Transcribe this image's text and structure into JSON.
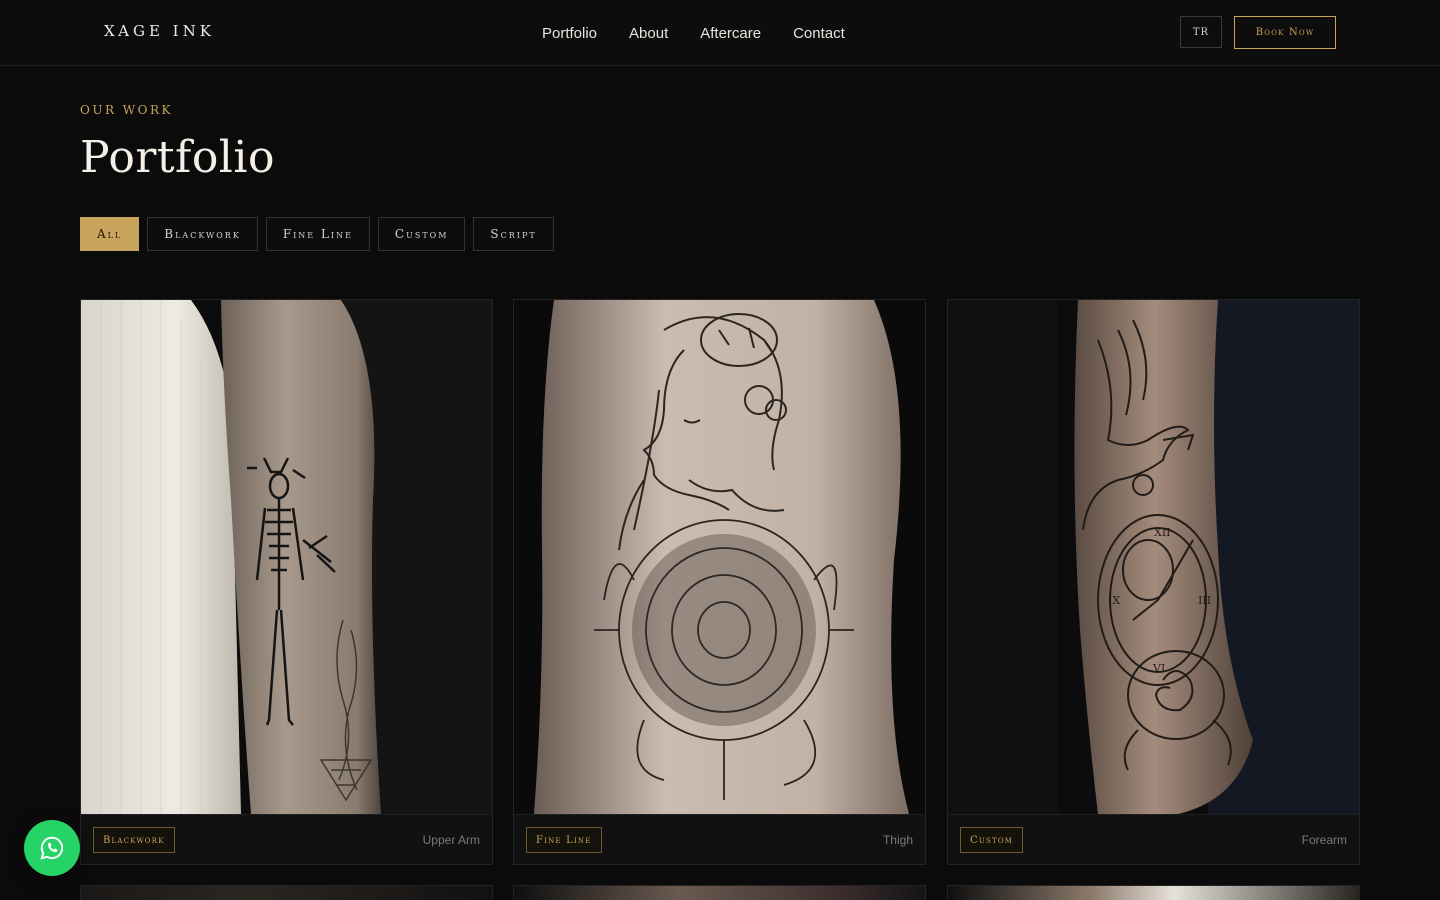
{
  "brand": {
    "logo": "XAGE INK",
    "accent": "#c8a45c"
  },
  "nav": {
    "items": [
      "Portfolio",
      "About",
      "Aftercare",
      "Contact"
    ]
  },
  "header": {
    "lang": "TR",
    "book": "Book Now"
  },
  "section": {
    "eyebrow": "OUR WORK",
    "title": "Portfolio"
  },
  "filters": {
    "items": [
      "All",
      "Blackwork",
      "Fine Line",
      "Custom",
      "Script"
    ],
    "active": "All"
  },
  "cards": [
    {
      "tag": "Blackwork",
      "location": "Upper Arm"
    },
    {
      "tag": "Fine Line",
      "location": "Thigh"
    },
    {
      "tag": "Custom",
      "location": "Forearm"
    }
  ],
  "icons": {
    "whatsapp": "whatsapp-icon"
  }
}
